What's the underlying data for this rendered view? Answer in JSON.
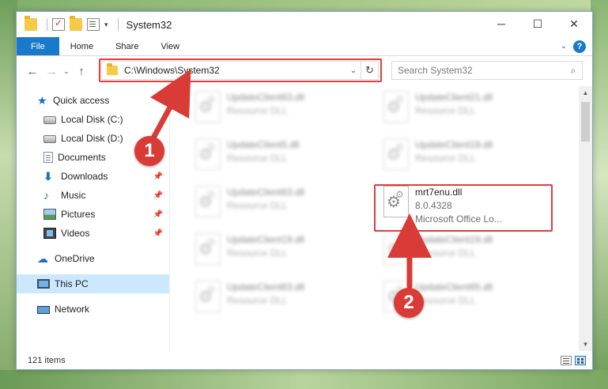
{
  "window": {
    "title": "System32",
    "minimize_label": "─",
    "maximize_label": "☐",
    "close_label": "✕"
  },
  "ribbon": {
    "tabs": [
      {
        "label": "File"
      },
      {
        "label": "Home"
      },
      {
        "label": "Share"
      },
      {
        "label": "View"
      }
    ],
    "help_label": "?"
  },
  "navigation": {
    "back": "←",
    "forward": "→",
    "recent": "⌄",
    "up": "↑",
    "address_path": "C:\\Windows\\System32",
    "refresh": "↻",
    "search_placeholder": "Search System32"
  },
  "sidebar": {
    "items": [
      {
        "label": "Quick access",
        "icon": "star-icon"
      },
      {
        "label": "Local Disk (C:)",
        "icon": "drive-icon"
      },
      {
        "label": "Local Disk (D:)",
        "icon": "drive-icon"
      },
      {
        "label": "Documents",
        "icon": "documents-icon",
        "pinned": true
      },
      {
        "label": "Downloads",
        "icon": "download-icon",
        "pinned": true
      },
      {
        "label": "Music",
        "icon": "music-icon",
        "pinned": true
      },
      {
        "label": "Pictures",
        "icon": "pictures-icon",
        "pinned": true
      },
      {
        "label": "Videos",
        "icon": "videos-icon",
        "pinned": true
      },
      {
        "label": "OneDrive",
        "icon": "cloud-icon"
      },
      {
        "label": "This PC",
        "icon": "computer-icon",
        "selected": true
      },
      {
        "label": "Network",
        "icon": "network-icon"
      }
    ],
    "pin_glyph": "📌"
  },
  "files": [
    {
      "name": "UpdateClient63.dll",
      "type": "Resource DLL",
      "blurred": true
    },
    {
      "name": "UpdateClient21.dll",
      "type": "Resource DLL",
      "blurred": true
    },
    {
      "name": "UpdateClient5.dll",
      "type": "Resource DLL",
      "blurred": true
    },
    {
      "name": "UpdateClient19.dll",
      "type": "Resource DLL",
      "blurred": true
    },
    {
      "name": "UpdateClient63.dll",
      "type": "Resource DLL",
      "blurred": true
    },
    {
      "name": "mrt7enu.dll",
      "version": "8.0.4328",
      "type": "Microsoft Office Lo...",
      "blurred": false
    },
    {
      "name": "UpdateClient19.dll",
      "type": "Resource DLL",
      "blurred": true
    },
    {
      "name": "UpdateClient19.dll",
      "type": "Resource DLL",
      "blurred": true
    },
    {
      "name": "UpdateClient63.dll",
      "type": "Resource DLL",
      "blurred": true
    },
    {
      "name": "UpdateClient65.dll",
      "type": "Resource DLL",
      "blurred": true
    }
  ],
  "status": {
    "item_count": "121 items"
  },
  "annotations": {
    "step1": "1",
    "step2": "2",
    "color": "#d93b36"
  }
}
